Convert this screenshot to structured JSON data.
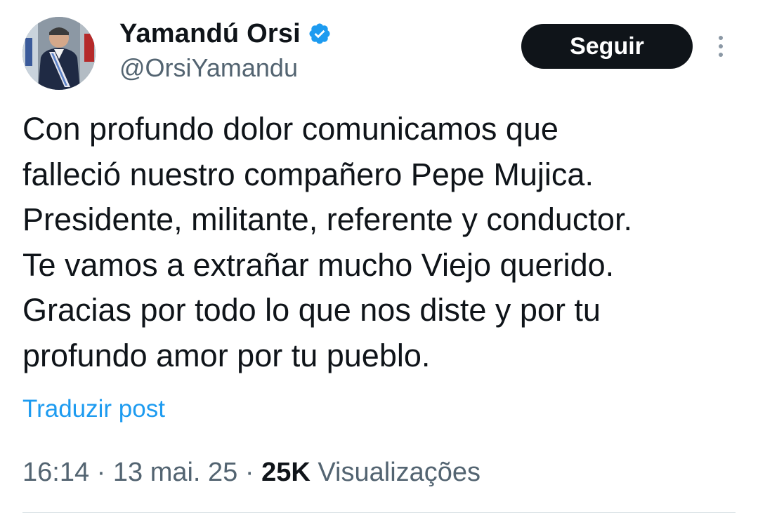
{
  "author": {
    "display_name": "Yamandú Orsi",
    "handle": "@OrsiYamandu",
    "verified_icon": "verified-badge-icon",
    "avatar_icon": "avatar"
  },
  "actions": {
    "follow_label": "Seguir",
    "more_icon": "more-vertical-icon"
  },
  "tweet": {
    "text": "Con profundo dolor comunicamos que\nfalleció nuestro compañero Pepe Mujica.\nPresidente, militante, referente y conductor.\nTe vamos a extrañar mucho Viejo querido.\nGracias por todo lo que nos diste y por tu\nprofundo amor por tu pueblo.",
    "translate_label": "Traduzir post"
  },
  "meta": {
    "time": "16:14",
    "separator": " · ",
    "date": "13 mai. 25",
    "views_count": "25K",
    "views_label": "Visualizações"
  },
  "colors": {
    "text_primary": "#0f1419",
    "text_secondary": "#536471",
    "link": "#1d9bf0",
    "verified": "#1d9bf0",
    "button_bg": "#0f1419"
  }
}
